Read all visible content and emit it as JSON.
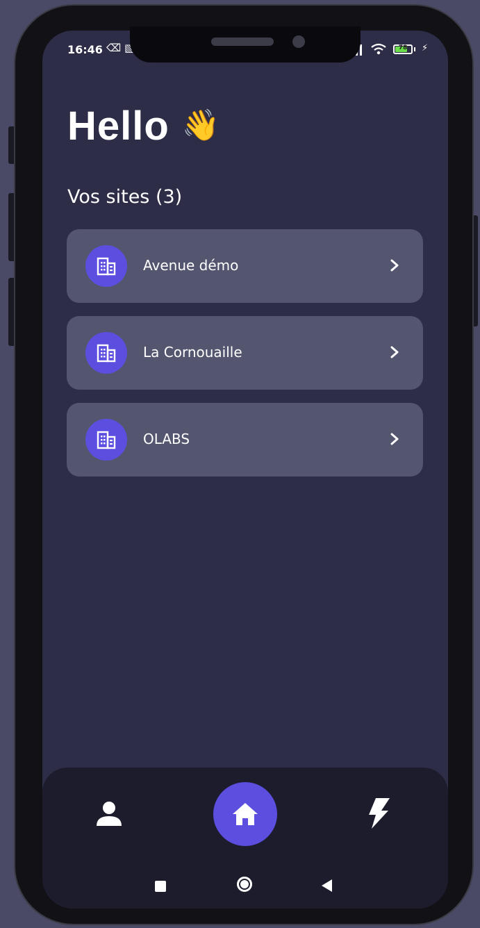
{
  "status_bar": {
    "time": "16:46",
    "battery_level": "78",
    "battery_fraction": 0.78,
    "battery_color": "#6bdc4a"
  },
  "header": {
    "greeting": "Hello",
    "wave_emoji": "👋"
  },
  "sites": {
    "title": "Vos sites (3)",
    "items": [
      {
        "name": "Avenue démo",
        "icon": "building-icon"
      },
      {
        "name": "La Cornouaille",
        "icon": "building-icon"
      },
      {
        "name": "OLABS",
        "icon": "building-icon"
      }
    ]
  },
  "bottom_nav": {
    "items": [
      {
        "icon": "user-icon",
        "active": false
      },
      {
        "icon": "home-icon",
        "active": true
      },
      {
        "icon": "bolt-icon",
        "active": false
      }
    ]
  },
  "colors": {
    "background": "#2d2d48",
    "card": "#545670",
    "accent": "#5c4fe0",
    "nav_background": "#1c1c2c"
  }
}
